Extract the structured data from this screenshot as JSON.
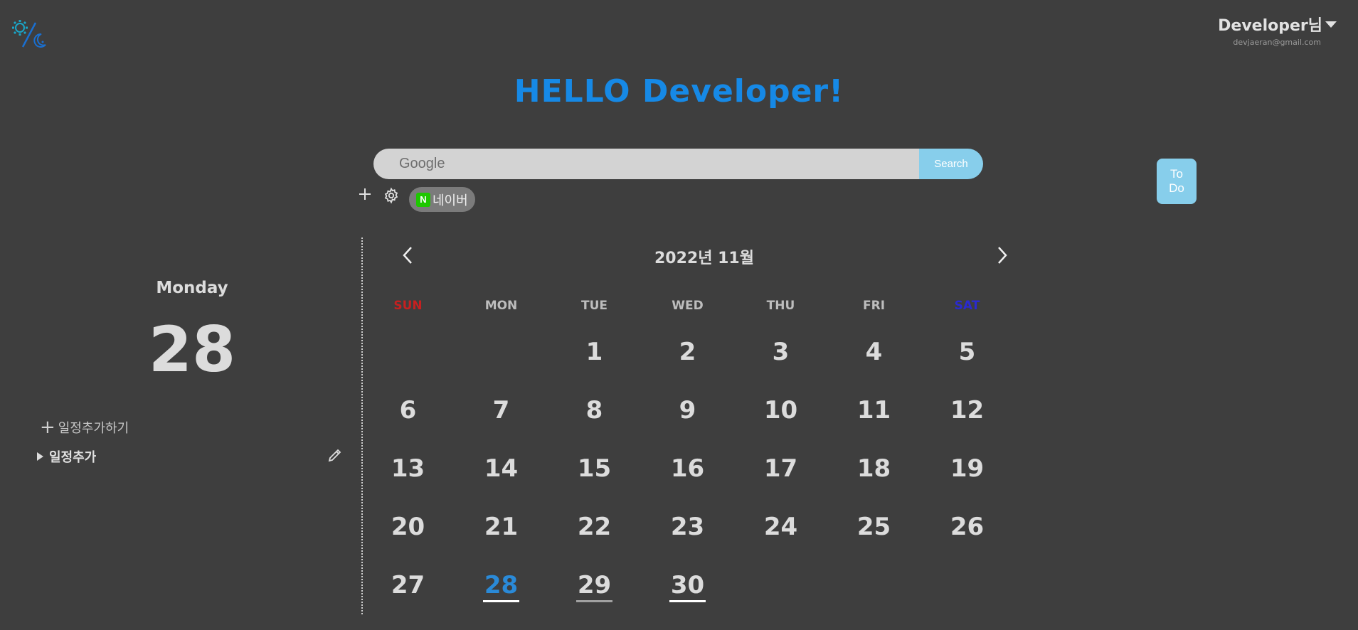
{
  "user": {
    "name": "Developer님",
    "email": "devjaeran@gmail.com"
  },
  "greeting": "HELLO Developer!",
  "search": {
    "placeholder": "Google",
    "button_label": "Search"
  },
  "shortcuts": [
    {
      "label": "네이버",
      "badge": "N",
      "color": "#1ec800"
    }
  ],
  "todo_label_line1": "To",
  "todo_label_line2": "Do",
  "left_panel": {
    "day_name": "Monday",
    "day_number": "28",
    "add_schedule_label": "일정추가하기",
    "schedule_items": [
      {
        "label": "일정추가"
      }
    ]
  },
  "calendar": {
    "title": "2022년 11월",
    "weekdays": [
      "SUN",
      "MON",
      "TUE",
      "WED",
      "THU",
      "FRI",
      "SAT"
    ],
    "weeks": [
      [
        "",
        "",
        "1",
        "2",
        "3",
        "4",
        "5"
      ],
      [
        "6",
        "7",
        "8",
        "9",
        "10",
        "11",
        "12"
      ],
      [
        "13",
        "14",
        "15",
        "16",
        "17",
        "18",
        "19"
      ],
      [
        "20",
        "21",
        "22",
        "23",
        "24",
        "25",
        "26"
      ],
      [
        "27",
        "28",
        "29",
        "30",
        "",
        "",
        ""
      ]
    ],
    "today": "28",
    "marked_days": [
      "29",
      "30"
    ]
  },
  "colors": {
    "background": "#3e3e3e",
    "accent": "#1689e6",
    "button": "#87ceeb",
    "sunday": "#c62020",
    "saturday": "#2a2ad0"
  },
  "icons": {
    "logo": "gear-moon-percent-logo",
    "add_shortcut": "plus-icon",
    "shortcut_settings": "gear-icon",
    "edit": "pencil-icon",
    "prev": "chevron-left-icon",
    "next": "chevron-right-icon"
  }
}
